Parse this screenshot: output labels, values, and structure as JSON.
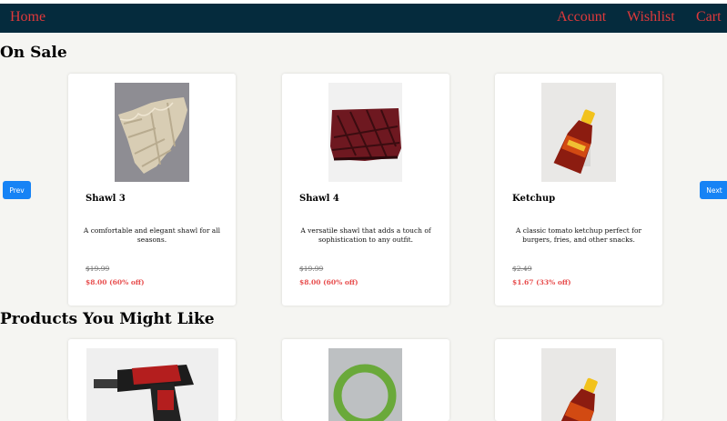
{
  "nav": {
    "home": "Home",
    "account": "Account",
    "wishlist": "Wishlist",
    "cart": "Cart",
    "bg_color": "#052b3d",
    "link_color": "#e0393b"
  },
  "on_sale": {
    "title": "On Sale",
    "prev_label": "Prev",
    "next_label": "Next",
    "items": [
      {
        "name": "Shawl 3",
        "description": "A comfortable and elegant shawl for all seasons.",
        "original_price": "$19.99",
        "sale_price": "$8.00 (60% off)",
        "image": "knit-shawl-photo"
      },
      {
        "name": "Shawl 4",
        "description": "A versatile shawl that adds a touch of sophistication to any outfit.",
        "original_price": "$19.99",
        "sale_price": "$8.00 (60% off)",
        "image": "red-shawl-photo"
      },
      {
        "name": "Ketchup",
        "description": "A classic tomato ketchup perfect for burgers, fries, and other snacks.",
        "original_price": "$2.49",
        "sale_price": "$1.67 (33% off)",
        "image": "ketchup-bottle-photo"
      }
    ]
  },
  "recommended": {
    "title": "Products You Might Like",
    "items": [
      {
        "image": "power-drill-photo"
      },
      {
        "image": "green-ring-toy-photo"
      },
      {
        "image": "ketchup-bottle-photo"
      }
    ]
  },
  "colors": {
    "button": "#1683f5",
    "sale_price": "#e74c4c",
    "page_bg": "#f5f5f2"
  }
}
